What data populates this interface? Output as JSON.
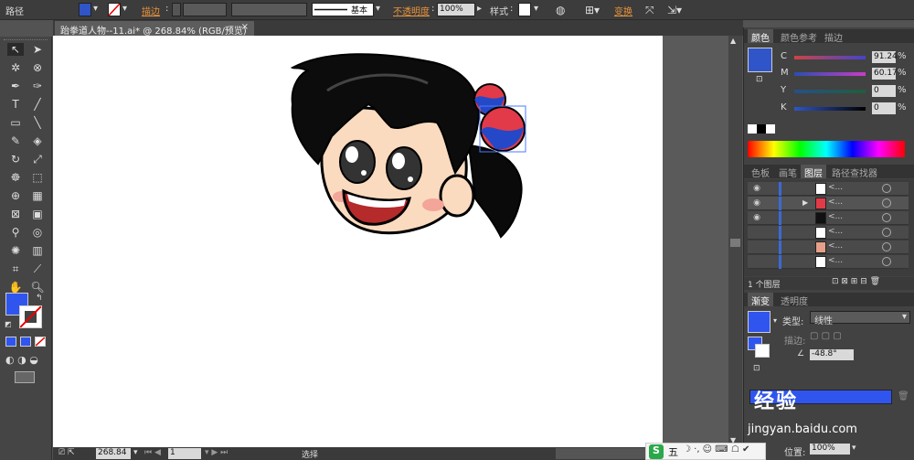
{
  "control_bar": {
    "selection_label": "路径",
    "stroke_label": "描边",
    "stroke_profile": "基本",
    "opacity_label": "不透明度",
    "opacity_value": "100%",
    "style_label": "样式",
    "transform_label": "变换"
  },
  "document": {
    "tab_title": "跆拳道人物--11.ai* @ 268.84% (RGB/预览)"
  },
  "status_bar": {
    "zoom": "268.84",
    "page": "1",
    "tool_status": "选择"
  },
  "color_panel": {
    "tabs": [
      "颜色",
      "颜色参考",
      "描边"
    ],
    "channels": [
      {
        "label": "C",
        "value": "91.24",
        "unit": "%"
      },
      {
        "label": "M",
        "value": "60.17",
        "unit": "%"
      },
      {
        "label": "Y",
        "value": "0",
        "unit": "%"
      },
      {
        "label": "K",
        "value": "0",
        "unit": "%"
      }
    ],
    "fill_color": "#2f55c8"
  },
  "layers_panel": {
    "tabs": [
      "色板",
      "画笔",
      "图层",
      "路径查找器"
    ],
    "footer": "1 个图层",
    "row_label": "<..."
  },
  "gradient_panel": {
    "tabs": [
      "渐变",
      "透明度"
    ],
    "type_label": "类型:",
    "type_value": "线性",
    "stroke_label": "描边:",
    "angle_value": "-48.8°",
    "position_label": "位置:",
    "position_value": "100%"
  },
  "watermark": {
    "text": "经验",
    "url": "jingyan.baidu.com"
  },
  "ime": {
    "label": "五"
  },
  "colors": {
    "accent_blue": "#2f55c8",
    "panel_bg": "#424242"
  }
}
